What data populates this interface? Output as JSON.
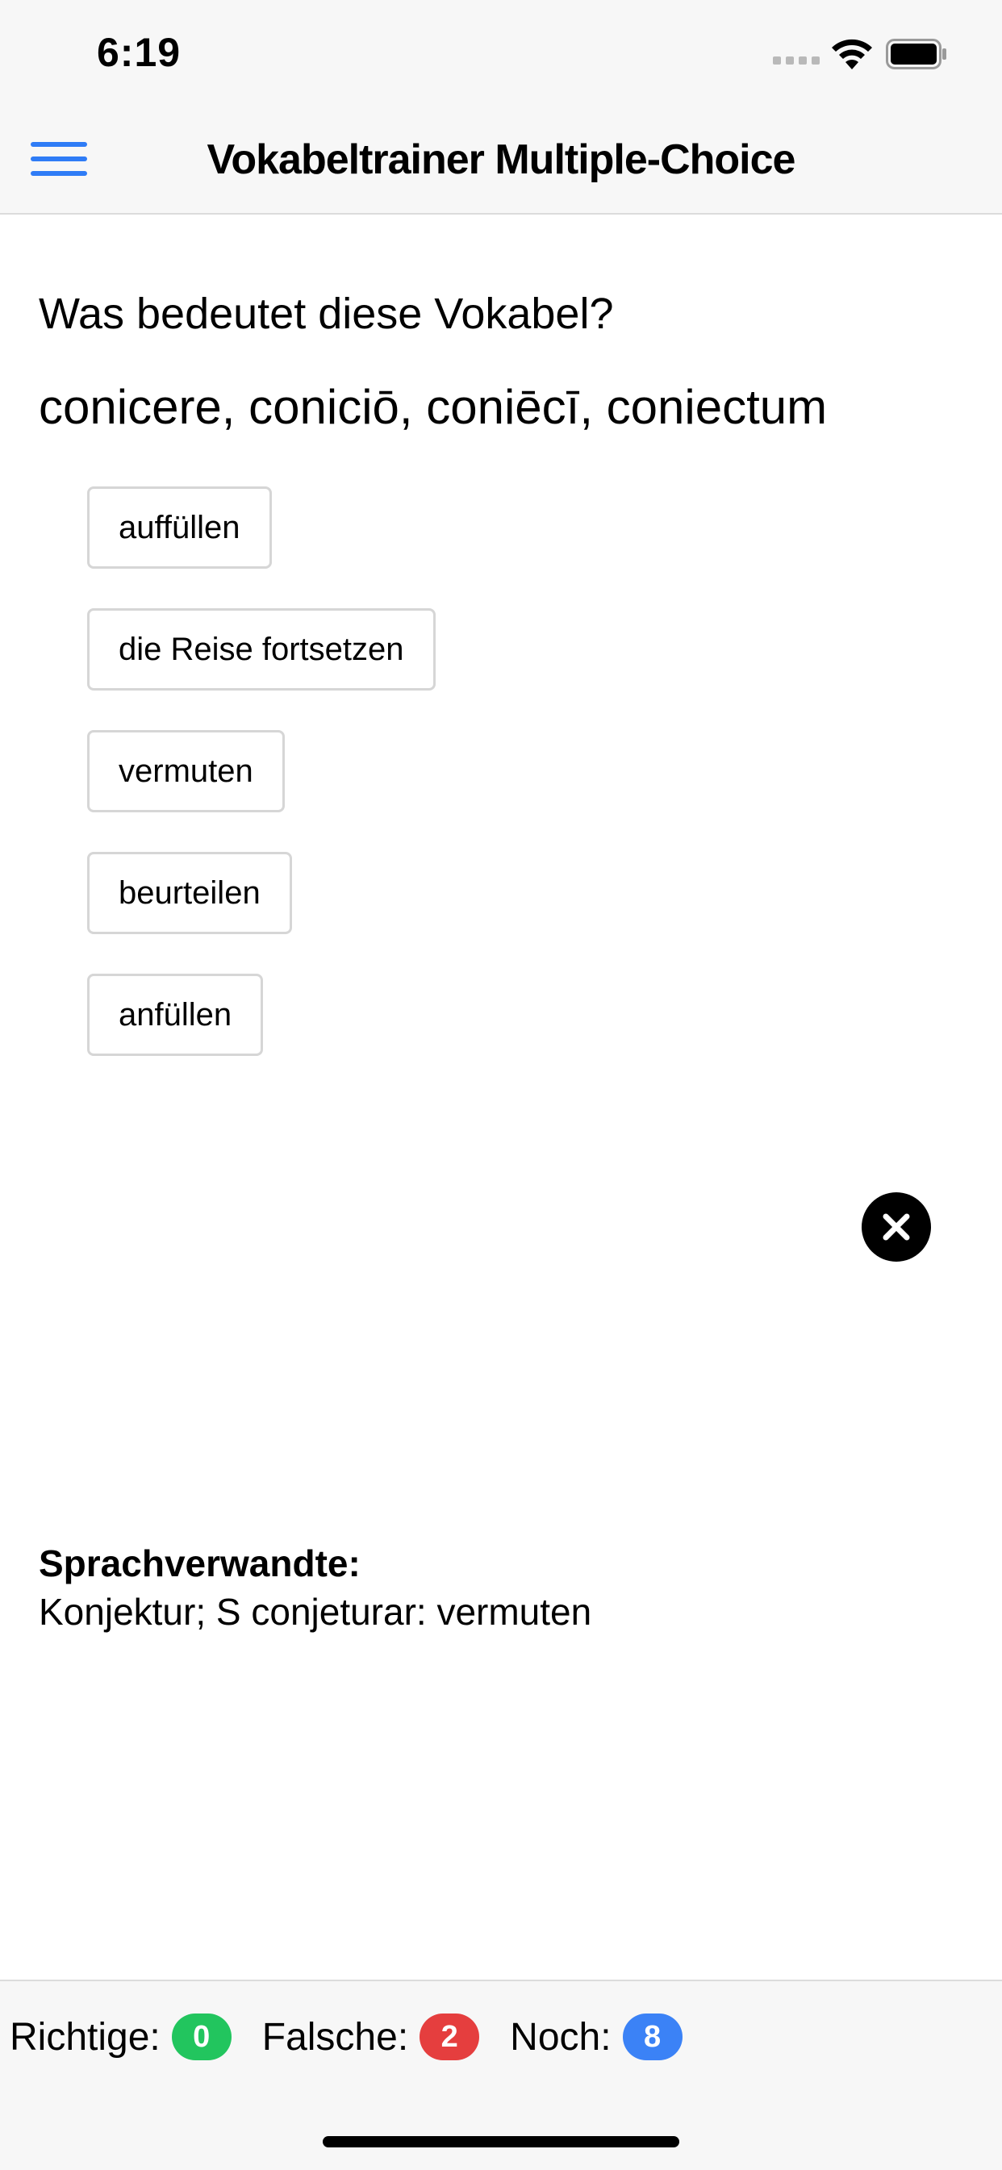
{
  "status_bar": {
    "time": "6:19"
  },
  "header": {
    "title": "Vokabeltrainer Multiple-Choice",
    "menu_icon": "hamburger-menu-icon"
  },
  "quiz": {
    "question": "Was bedeutet diese Vokabel?",
    "vocab": "conicere, coniciō, coniēcī, coniectum",
    "answers": [
      "auffüllen",
      "die Reise fortsetzen",
      "vermuten",
      "beurteilen",
      "anfüllen"
    ],
    "close_icon": "close-icon"
  },
  "related": {
    "label": "Sprachverwandte:",
    "text": "Konjektur; S conjeturar: vermuten"
  },
  "footer": {
    "correct_label": "Richtige:",
    "correct_count": "0",
    "wrong_label": "Falsche:",
    "wrong_count": "2",
    "remaining_label": "Noch:",
    "remaining_count": "8"
  },
  "colors": {
    "accent": "#2f7cf6",
    "correct": "#22c55e",
    "wrong": "#e53e3e",
    "remaining": "#3b82f6"
  }
}
